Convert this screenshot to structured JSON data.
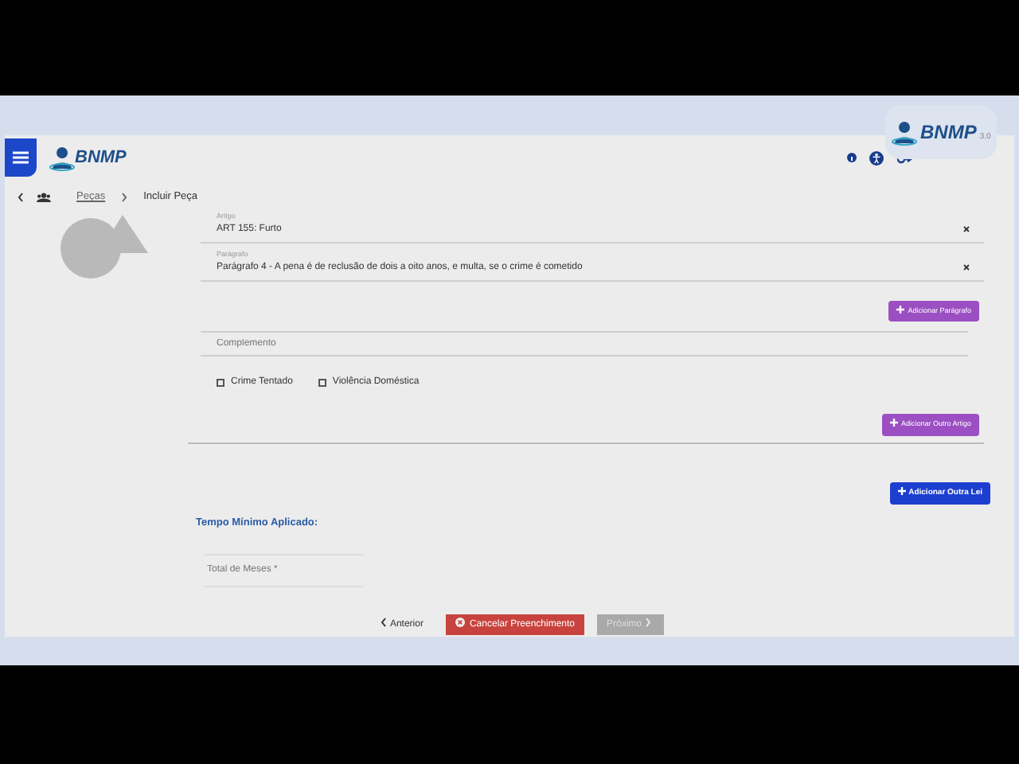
{
  "header": {
    "logo": "BNMP",
    "badge_logo": "BNMP",
    "badge_version": "3.0"
  },
  "breadcrumb": [
    {
      "label": "Peças",
      "link": true
    },
    {
      "label": "Incluir Peça",
      "link": false
    }
  ],
  "fields": [
    {
      "kind": "select",
      "label": "Artigo",
      "value": "ART 155: Furto"
    },
    {
      "kind": "select",
      "label": "Parágrafo",
      "value": "Parágrafo 4 - A pena é de reclusão de dois a oito anos, e multa, se o crime é cometido"
    },
    {
      "kind": "button",
      "label": "Adicionar Parágrafo"
    },
    {
      "kind": "text",
      "placeholder": "Complemento"
    }
  ],
  "checkboxes": [
    {
      "label": "Crime Tentado",
      "checked": false
    },
    {
      "label": "Violência Doméstica",
      "checked": false
    }
  ],
  "add_article": "Adicionar Outro Artigo",
  "add_law": "Adicionar Outra Lei",
  "section_title": "Tempo Mínimo Aplicado:",
  "months_field": {
    "placeholder": "Total de Meses *"
  },
  "footer": [
    {
      "kind": "back",
      "label": "Anterior",
      "disabled": false
    },
    {
      "kind": "cancel",
      "label": "Cancelar Preenchimento",
      "disabled": false
    },
    {
      "kind": "next",
      "label": "Próximo",
      "disabled": true
    }
  ]
}
